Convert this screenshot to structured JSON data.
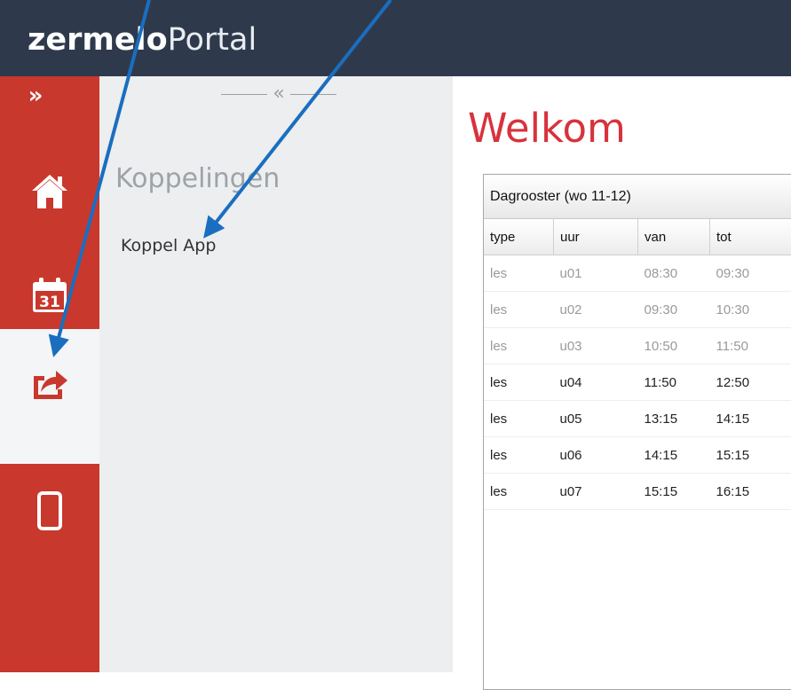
{
  "header": {
    "logo_strong": "zermelo",
    "logo_light": "Portal"
  },
  "rail": {
    "expand_glyph": "»",
    "items": [
      {
        "name": "home",
        "icon": "home-icon"
      },
      {
        "name": "calendar",
        "icon": "calendar-icon",
        "day": "31"
      },
      {
        "name": "share",
        "icon": "share-icon"
      },
      {
        "name": "phone",
        "icon": "phone-icon"
      }
    ],
    "accent": "#c8382d"
  },
  "panel": {
    "collapse_glyph": "«",
    "title": "Koppelingen",
    "link": "Koppel App"
  },
  "main": {
    "welcome": "Welkom",
    "widget": {
      "title": "Dagrooster (wo 11-12)",
      "columns": [
        "type",
        "uur",
        "van",
        "tot"
      ],
      "rows": [
        {
          "type": "les",
          "uur": "u01",
          "van": "08:30",
          "tot": "09:30",
          "past": true
        },
        {
          "type": "les",
          "uur": "u02",
          "van": "09:30",
          "tot": "10:30",
          "past": true
        },
        {
          "type": "les",
          "uur": "u03",
          "van": "10:50",
          "tot": "11:50",
          "past": true
        },
        {
          "type": "les",
          "uur": "u04",
          "van": "11:50",
          "tot": "12:50",
          "past": false
        },
        {
          "type": "les",
          "uur": "u05",
          "van": "13:15",
          "tot": "14:15",
          "past": false
        },
        {
          "type": "les",
          "uur": "u06",
          "van": "14:15",
          "tot": "15:15",
          "past": false
        },
        {
          "type": "les",
          "uur": "u07",
          "van": "15:15",
          "tot": "16:15",
          "past": false
        }
      ]
    }
  },
  "colors": {
    "header_bg": "#2e3a4c",
    "welcome": "#d8323c",
    "annotation_arrow": "#1a6ec0"
  }
}
